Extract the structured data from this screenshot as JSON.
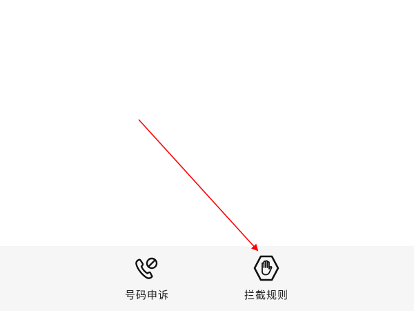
{
  "bottom_bar": {
    "actions": [
      {
        "label": "号码申诉",
        "icon": "phone-blocked-icon"
      },
      {
        "label": "拦截规则",
        "icon": "hand-stop-hexagon-icon"
      }
    ]
  },
  "annotation": {
    "arrow_color": "#ff0000"
  },
  "colors": {
    "background": "#ffffff",
    "bottom_bar": "#f6f6f6",
    "text": "#1a1a1a",
    "icon": "#111111"
  }
}
